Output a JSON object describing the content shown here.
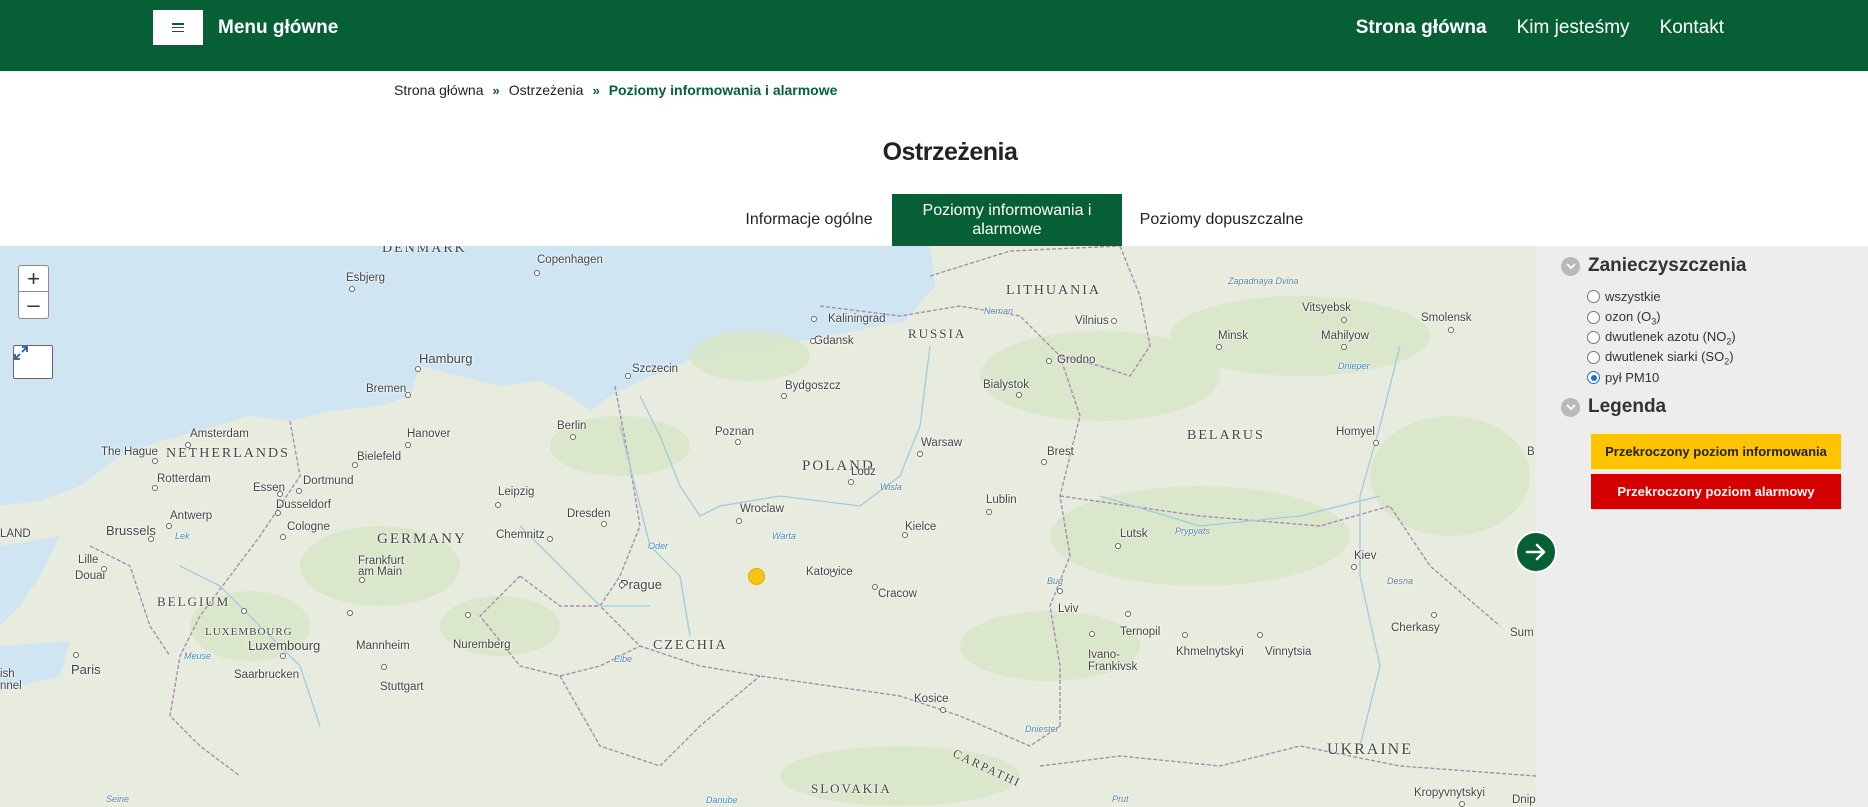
{
  "header": {
    "menu_label": "Menu główne",
    "nav": [
      "Strona główna",
      "Kim jesteśmy",
      "Kontakt"
    ]
  },
  "breadcrumb": {
    "items": [
      "Strona główna",
      "Ostrzeżenia"
    ],
    "current": "Poziomy informowania i alarmowe",
    "separator": "»"
  },
  "page_title": "Ostrzeżenia",
  "tabs": {
    "general": "Informacje ogólne",
    "levels": "Poziomy informowania i alarmowe",
    "allowed": "Poziomy dopuszczalne",
    "active": "levels"
  },
  "map": {
    "controls": {
      "zoom_in": "+",
      "zoom_out": "–"
    },
    "countries": [
      "DENMARK",
      "LITHUANIA",
      "RUSSIA",
      "NETHERLANDS",
      "POLAND",
      "BELARUS",
      "GERMANY",
      "BELGIUM",
      "LUXEMBOURG",
      "CZECHIA",
      "SLOVAKIA",
      "UKRAINE",
      "CARPATHI"
    ],
    "cities": [
      "Copenhagen",
      "Esbjerg",
      "Kaliningrad",
      "Gdansk",
      "Vilnius",
      "Vitsyebsk",
      "Smolensk",
      "Hamburg",
      "Szczecin",
      "Minsk",
      "Mahilyow",
      "Bremen",
      "Bydgoszcz",
      "Bialystok",
      "Grodno",
      "Amsterdam",
      "Berlin",
      "Hanover",
      "Poznan",
      "Warsaw",
      "The Hague",
      "Bielefeld",
      "Brest",
      "Homyel",
      "Rotterdam",
      "Lodz",
      "Essen",
      "Dortmund",
      "Leipzig",
      "Dusseldorf",
      "Antwerp",
      "Dresden",
      "Wroclaw",
      "Lublin",
      "Cologne",
      "Kielce",
      "Brussels",
      "Chemnitz",
      "Lutsk",
      "Lille",
      "Frankfurt am Main",
      "Katowice",
      "Kiev",
      "Douai",
      "Prague",
      "Cracow",
      "Luxembourg",
      "Mannheim",
      "Nuremberg",
      "Lviv",
      "Ternopil",
      "Cherkasy",
      "Paris",
      "Saarbrucken",
      "Stuttgart",
      "Ivano-Frankivsk",
      "Khmelnytskyi",
      "Vinnytsia",
      "Kosice",
      "Kropyvnytskyi",
      "Sum",
      "Dnip",
      "B",
      "LAND",
      "ish",
      "nnel"
    ],
    "water": [
      "Neman",
      "Wisla",
      "Warta",
      "Oder",
      "Elbe",
      "Dnieper",
      "Prypyats",
      "Desna",
      "Bug",
      "Zapadnaya Dvina",
      "Dniester",
      "Lek",
      "Meuse",
      "Seine",
      "Prut",
      "Danube"
    ],
    "station_color": "#f5c518"
  },
  "panel": {
    "pollutants_title": "Zanieczyszczenia",
    "options": [
      {
        "label": "wszystkie",
        "checked": false
      },
      {
        "label": "ozon (O",
        "sub": "3",
        "suffix": ")",
        "checked": false
      },
      {
        "label": "dwutlenek azotu (NO",
        "sub": "2",
        "suffix": ")",
        "checked": false
      },
      {
        "label": "dwutlenek siarki (SO",
        "sub": "2",
        "suffix": ")",
        "checked": false
      },
      {
        "label": "pył PM10",
        "checked": true
      }
    ],
    "legend_title": "Legenda",
    "legend": [
      {
        "label": "Przekroczony poziom informowania",
        "color": "#ffc400"
      },
      {
        "label": "Przekroczony poziom alarmowy",
        "color": "#d40000"
      }
    ]
  },
  "colors": {
    "brand": "#075f35",
    "sea": "#cfe6f2",
    "land": "#e8ecde"
  }
}
